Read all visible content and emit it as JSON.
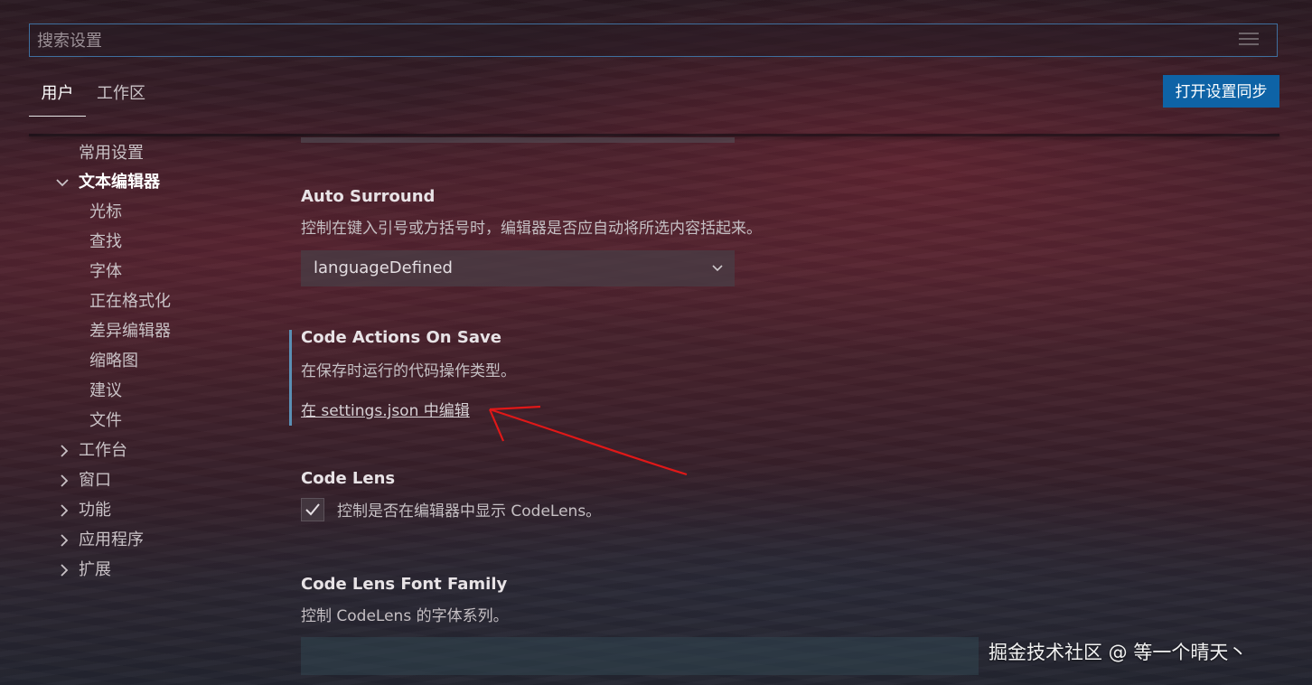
{
  "search": {
    "placeholder": "搜索设置",
    "value": ""
  },
  "tabs": [
    {
      "label": "用户",
      "active": true
    },
    {
      "label": "工作区",
      "active": false
    }
  ],
  "sync_button": {
    "label": "打开设置同步"
  },
  "toc": {
    "items": [
      {
        "label": "常用设置",
        "level": 0,
        "expanded": null
      },
      {
        "label": "文本编辑器",
        "level": 0,
        "expanded": true,
        "bold": true
      },
      {
        "label": "光标",
        "level": 1
      },
      {
        "label": "查找",
        "level": 1
      },
      {
        "label": "字体",
        "level": 1
      },
      {
        "label": "正在格式化",
        "level": 1
      },
      {
        "label": "差异编辑器",
        "level": 1
      },
      {
        "label": "缩略图",
        "level": 1
      },
      {
        "label": "建议",
        "level": 1
      },
      {
        "label": "文件",
        "level": 1
      },
      {
        "label": "工作台",
        "level": 0,
        "expanded": false
      },
      {
        "label": "窗口",
        "level": 0,
        "expanded": false
      },
      {
        "label": "功能",
        "level": 0,
        "expanded": false
      },
      {
        "label": "应用程序",
        "level": 0,
        "expanded": false
      },
      {
        "label": "扩展",
        "level": 0,
        "expanded": false
      }
    ]
  },
  "settings": {
    "auto_surround": {
      "title": "Auto Surround",
      "description": "控制在键入引号或方括号时，编辑器是否应自动将所选内容括起来。",
      "value": "languageDefined"
    },
    "code_actions_on_save": {
      "title": "Code Actions On Save",
      "description": "在保存时运行的代码操作类型。",
      "link": "在 settings.json 中编辑"
    },
    "code_lens": {
      "title": "Code Lens",
      "description": "控制是否在编辑器中显示 CodeLens。",
      "checked": true
    },
    "code_lens_font_family": {
      "title": "Code Lens Font Family",
      "description": "控制 CodeLens 的字体系列。",
      "value": ""
    }
  },
  "watermark": "掘金技术社区 @ 等一个晴天丶",
  "colors": {
    "accent": "#0e63a6",
    "focus_border": "#3f6f9e",
    "annotation_arrow": "#e01818"
  }
}
